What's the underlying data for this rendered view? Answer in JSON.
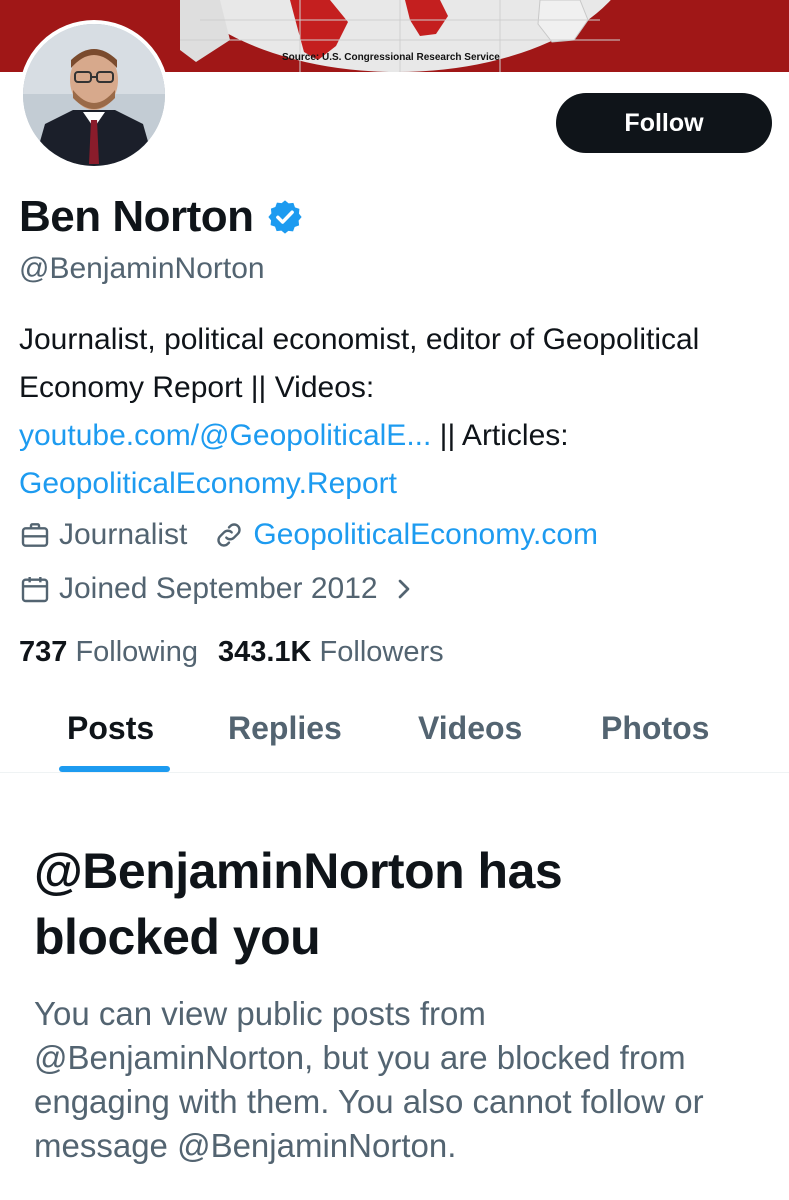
{
  "banner": {
    "caption": "Source: U.S. Congressional Research Service",
    "colors": {
      "background": "#a01717",
      "map_land": "#c41f1f",
      "globe": "#e8e8e8"
    }
  },
  "profile": {
    "display_name": "Ben Norton",
    "verified": true,
    "handle": "@BenjaminNorton",
    "follow_label": "Follow",
    "bio": {
      "text_1": "Journalist, political economist, editor of Geopolitical Economy Report || Videos:",
      "link_1": "youtube.com/@GeopoliticalE...",
      "text_2": " || Articles:",
      "link_2": "GeopoliticalEconomy.Report"
    },
    "profession": "Journalist",
    "website": "GeopoliticalEconomy.com",
    "joined": "Joined September 2012",
    "following_count": "737",
    "following_label": "Following",
    "followers_count": "343.1K",
    "followers_label": "Followers"
  },
  "tabs": [
    {
      "label": "Posts",
      "active": true
    },
    {
      "label": "Replies",
      "active": false
    },
    {
      "label": "Videos",
      "active": false
    },
    {
      "label": "Photos",
      "active": false
    }
  ],
  "blocked": {
    "title": "@BenjaminNorton has blocked you",
    "message": "You can view public posts from @BenjaminNorton, but you are blocked from engaging with them. You also cannot follow or message @BenjaminNorton."
  },
  "icons": {
    "verified": "verified-badge-icon",
    "profession": "briefcase-icon",
    "website": "link-icon",
    "joined": "calendar-icon",
    "joined_more": "chevron-right-icon"
  },
  "colors": {
    "accent": "#1d9bf0",
    "text_primary": "#0f1419",
    "text_secondary": "#536471",
    "button": "#0f1419"
  }
}
